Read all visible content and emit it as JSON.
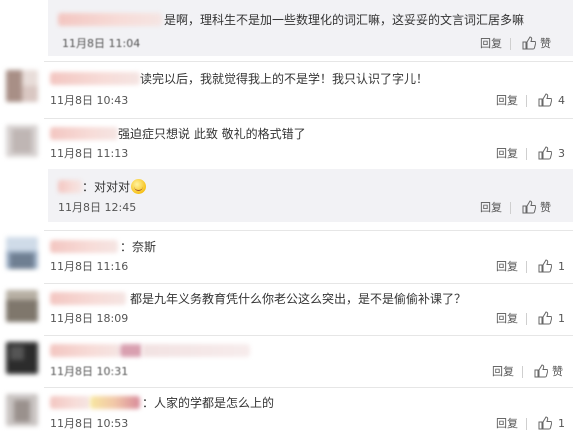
{
  "comments": [
    {
      "text": "是啊，理科生不是加一些数理化的词汇嘛，这妥妥的文言词汇居多嘛",
      "time": "11月8日 11:04",
      "reply": "回复",
      "like": "赞"
    },
    {
      "text": "读完以后，我就觉得我上的不是学！我只认识了字儿！",
      "time": "11月8日 10:43",
      "reply": "回复",
      "like_count": "4"
    },
    {
      "text": "强迫症只想说 此致 敬礼的格式错了",
      "time": "11月8日 11:13",
      "reply": "回复",
      "like_count": "3"
    },
    {
      "text": "：对对对",
      "time": "11月8日 12:45",
      "reply": "回复",
      "like": "赞"
    },
    {
      "text": "：奈斯",
      "time": "11月8日 11:16",
      "reply": "回复",
      "like_count": "1"
    },
    {
      "text": "都是九年义务教育凭什么你老公这么突出，是不是偷偷补课了？",
      "time": "11月8日 18:09",
      "reply": "回复",
      "like_count": "1"
    },
    {
      "text": "",
      "time": "11月8日 10:31",
      "reply": "回复",
      "like": "赞"
    },
    {
      "text": "：人家的学都是怎么上的",
      "time": "11月8日 10:53",
      "reply": "回复",
      "like_count": "1"
    }
  ],
  "icons": {
    "like": "thumbs-up-icon",
    "emoji": "grinning-face-emoji"
  },
  "colors": {
    "reply_box_bg": "#f2f2f5",
    "blur_pink": "#f3c6c1",
    "text": "#333333"
  }
}
